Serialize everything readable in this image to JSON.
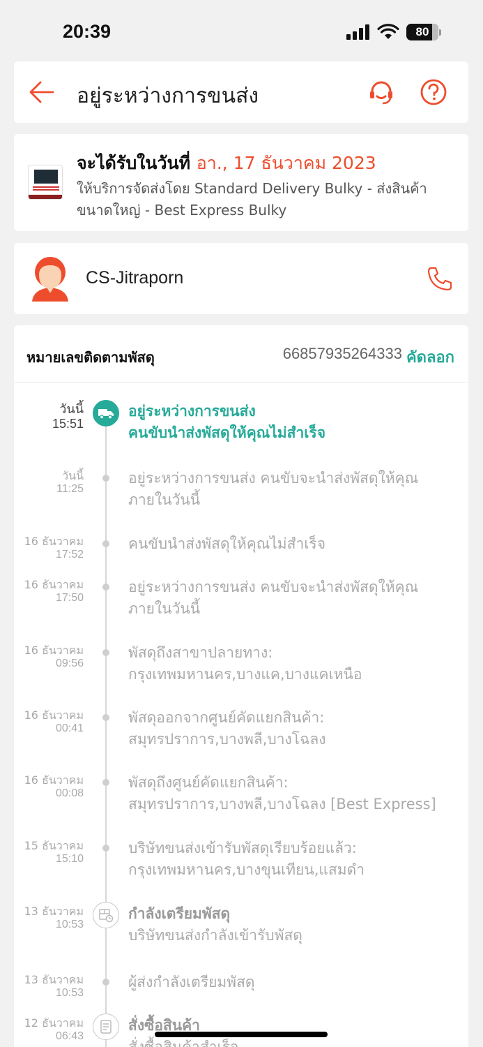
{
  "status_bar": {
    "time": "20:39",
    "battery": "80"
  },
  "header": {
    "title": "อยู่ระหว่างการขนส่ง"
  },
  "delivery": {
    "heading_prefix": "จะได้รับในวันที่ ",
    "date": "อา., 17 ธันวาคม 2023",
    "service": "ให้บริการจัดส่งโดย Standard Delivery Bulky - ส่งสินค้าขนาดใหญ่ - Best Express Bulky"
  },
  "courier": {
    "name": "CS-Jitraporn"
  },
  "tracking": {
    "label": "หมายเลขติดตามพัสดุ",
    "number": "66857935264333",
    "copy_label": "คัดลอก"
  },
  "events": [
    {
      "date": "วันนี้",
      "time": "15:51",
      "title": "อยู่ระหว่างการขนส่ง",
      "text": "คนขับนำส่งพัสดุให้คุณไม่สำเร็จ"
    },
    {
      "date": "วันนี้",
      "time": "11:25",
      "title": "",
      "text": "อยู่ระหว่างการขนส่ง คนขับจะนำส่งพัสดุให้คุณภายในวันนี้"
    },
    {
      "date": "16 ธันวาคม",
      "time": "17:52",
      "title": "",
      "text": "คนขับนำส่งพัสดุให้คุณไม่สำเร็จ"
    },
    {
      "date": "16 ธันวาคม",
      "time": "17:50",
      "title": "",
      "text": "อยู่ระหว่างการขนส่ง คนขับจะนำส่งพัสดุให้คุณภายในวันนี้"
    },
    {
      "date": "16 ธันวาคม",
      "time": "09:56",
      "title": "",
      "text": "พัสดุถึงสาขาปลายทาง: กรุงเทพมหานคร,บางแค,บางแคเหนือ"
    },
    {
      "date": "16 ธันวาคม",
      "time": "00:41",
      "title": "",
      "text": "พัสดุออกจากศูนย์คัดแยกสินค้า: สมุทรปราการ,บางพลี,บางโฉลง"
    },
    {
      "date": "16 ธันวาคม",
      "time": "00:08",
      "title": "",
      "text": "พัสดุถึงศูนย์คัดแยกสินค้า: สมุทรปราการ,บางพลี,บางโฉลง  [Best Express]"
    },
    {
      "date": "15 ธันวาคม",
      "time": "15:10",
      "title": "",
      "text": "บริษัทขนส่งเข้ารับพัสดุเรียบร้อยแล้ว: กรุงเทพมหานคร,บางขุนเทียน,แสมดำ"
    },
    {
      "date": "13 ธันวาคม",
      "time": "10:53",
      "title": "กำลังเตรียมพัสดุ",
      "text": "บริษัทขนส่งกำลังเข้ารับพัสดุ"
    },
    {
      "date": "13 ธันวาคม",
      "time": "10:53",
      "title": "",
      "text": " ผู้ส่งกำลังเตรียมพัสดุ"
    },
    {
      "date": "12 ธันวาคม",
      "time": "06:43",
      "title": "สั่งซื้อสินค้า",
      "text": "สั่งซื้อสินค้าสำเร็จ"
    }
  ],
  "colors": {
    "accent": "#ee4d2d",
    "teal": "#26aa99"
  },
  "icons": [
    "back-arrow-icon",
    "headset-icon",
    "help-icon",
    "phone-icon",
    "truck-icon",
    "package-clock-icon",
    "receipt-icon"
  ]
}
